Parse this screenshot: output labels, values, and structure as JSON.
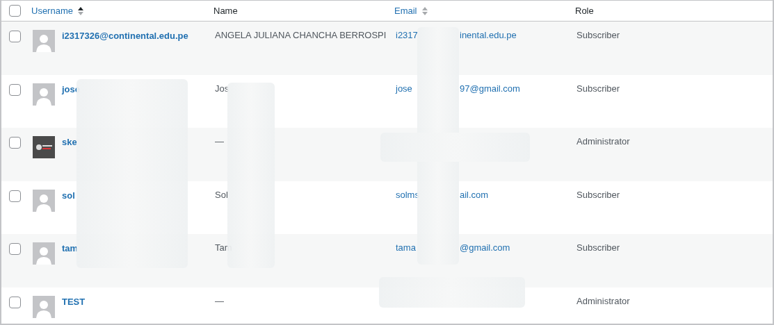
{
  "table": {
    "select_all": {
      "checked": false
    },
    "columns": [
      {
        "label": "Username",
        "kind": "sortable",
        "sorted": true
      },
      {
        "label": "Name",
        "kind": "plain"
      },
      {
        "label": "Email",
        "kind": "sortable",
        "sorted": false
      },
      {
        "label": "Role",
        "kind": "plain"
      }
    ],
    "rows": [
      {
        "checked": false,
        "kind": "default",
        "username": "i2317326@continental.edu.pe",
        "name": "ANGELA JULIANA CHANCHA BERROSPI",
        "email": [
          "i2317",
          "inental.edu.pe"
        ],
        "role": "Subscriber"
      },
      {
        "checked": false,
        "kind": "default",
        "username": "jose",
        "name": "Jos",
        "email": [
          "jose",
          "97@gmail.com"
        ],
        "role": "Subscriber"
      },
      {
        "checked": false,
        "kind": "logo",
        "username": "ske",
        "name": "—",
        "email": [],
        "role": "Administrator"
      },
      {
        "checked": false,
        "kind": "default",
        "username": "sol",
        "name": "Sol",
        "email": [
          "solms",
          "ail.com"
        ],
        "role": "Subscriber"
      },
      {
        "checked": false,
        "kind": "default",
        "username": "tam",
        "name": "Tam",
        "email": [
          "tama",
          "@gmail.com"
        ],
        "role": "Subscriber"
      },
      {
        "checked": false,
        "kind": "default",
        "username": "TEST",
        "name": "—",
        "email": [],
        "role": "Administrator"
      }
    ]
  }
}
